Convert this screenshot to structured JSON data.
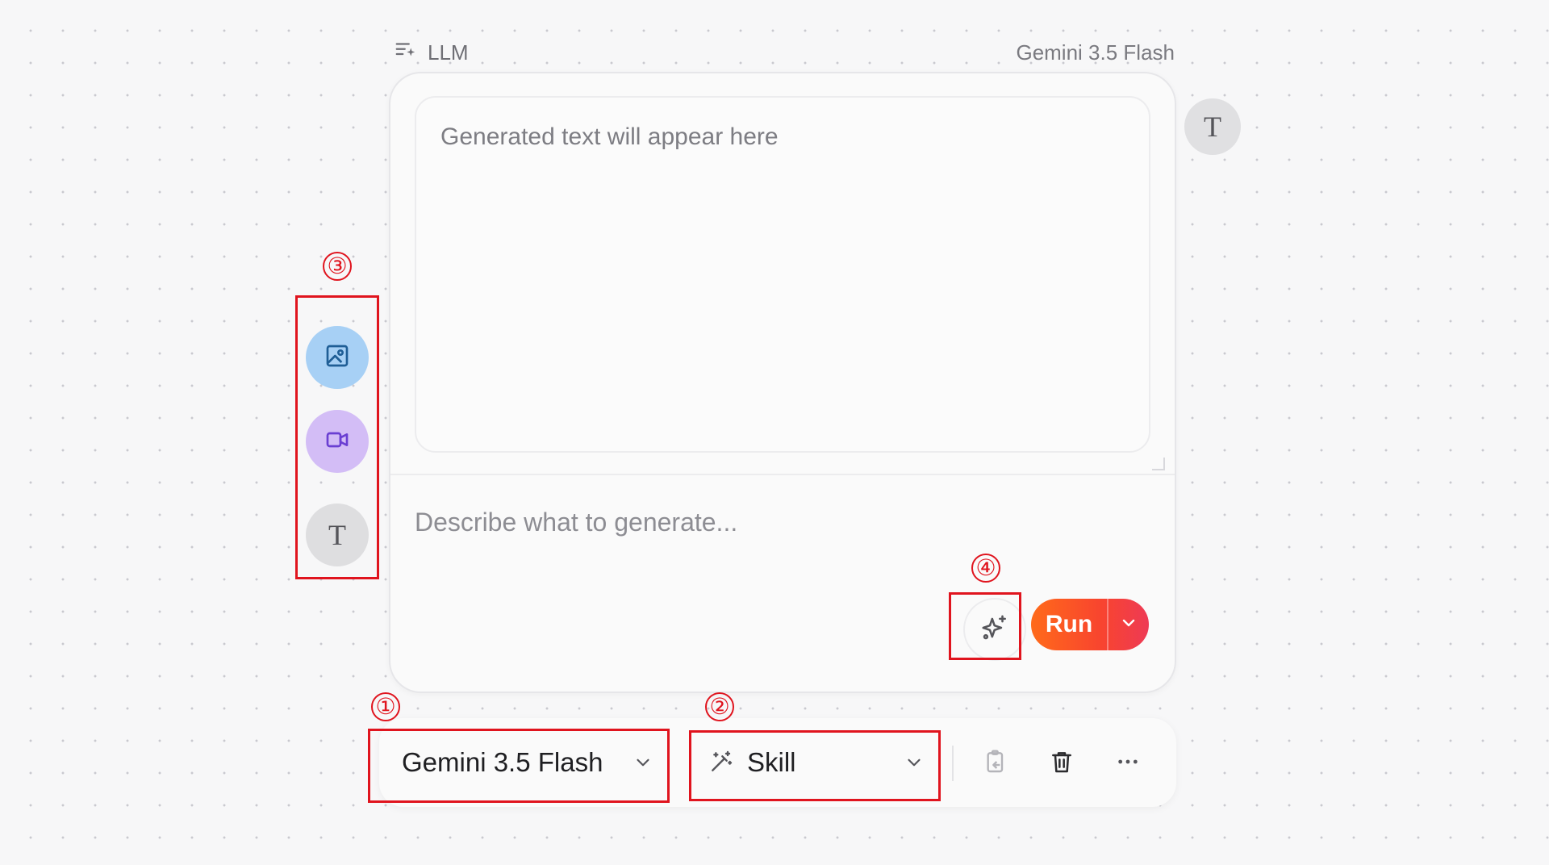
{
  "header": {
    "node_type_label": "LLM",
    "model_label": "Gemini 3.5 Flash"
  },
  "node": {
    "output_placeholder": "Generated text will appear here",
    "prompt_placeholder": "Describe what to generate...",
    "run_label": "Run"
  },
  "connectors": {
    "left": [
      {
        "type": "image",
        "icon": "image-icon",
        "color": "#a7d0f5"
      },
      {
        "type": "video",
        "icon": "video-icon",
        "color": "#d3bdf6"
      },
      {
        "type": "text",
        "icon": "text-icon",
        "glyph": "T",
        "color": "#dedee0"
      }
    ],
    "right": {
      "type": "text",
      "icon": "text-icon",
      "glyph": "T"
    }
  },
  "toolbar": {
    "model_select_value": "Gemini 3.5 Flash",
    "skill_select_value": "Skill",
    "actions": [
      "copy-icon",
      "trash-icon",
      "more-icon"
    ]
  },
  "annotations": {
    "badges": [
      "①",
      "②",
      "③",
      "④"
    ],
    "color": "#e0141e"
  },
  "colors": {
    "run_gradient_start": "#ff6a1a",
    "run_gradient_end": "#ee3a55",
    "canvas_bg": "#f7f7f8"
  }
}
